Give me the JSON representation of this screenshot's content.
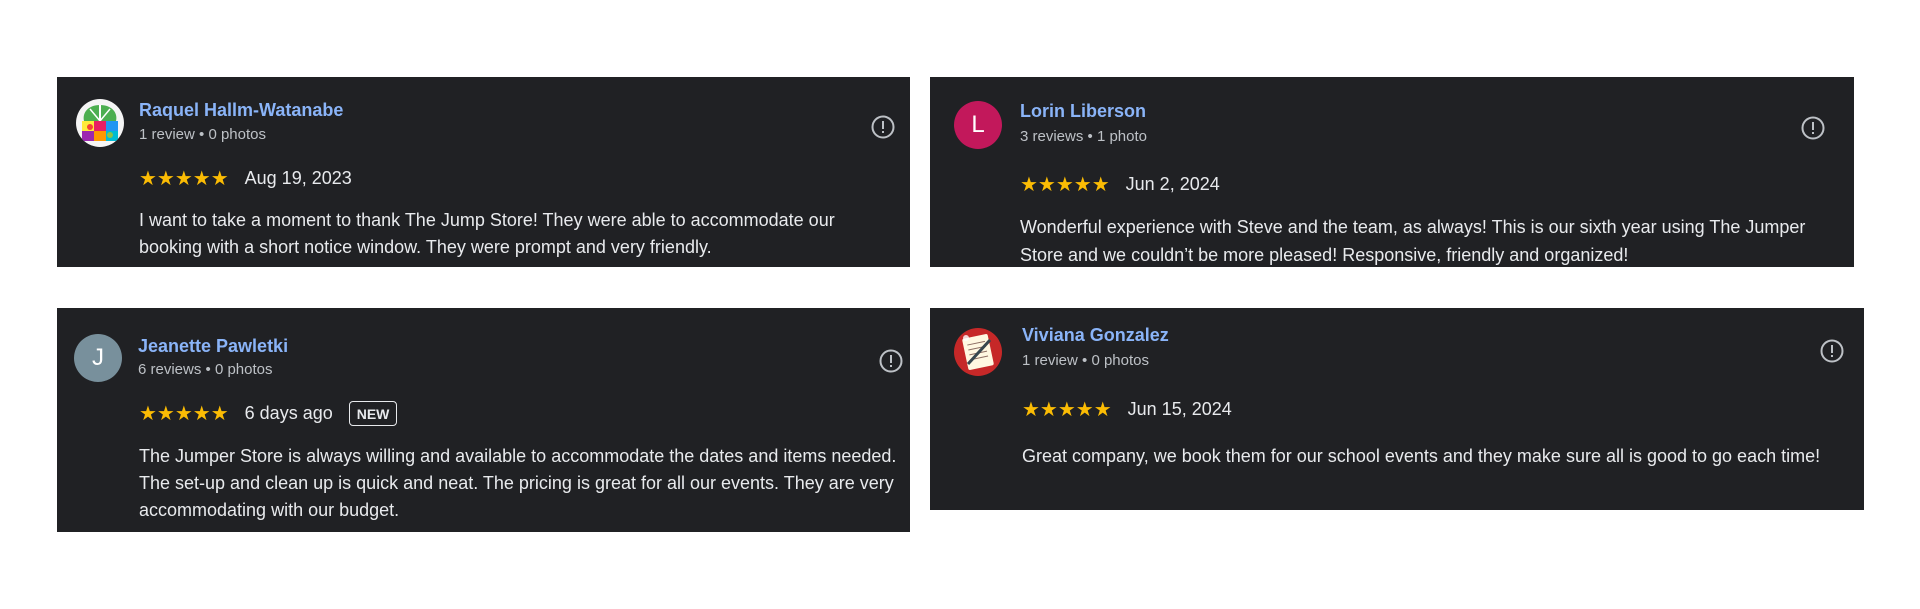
{
  "reviews": [
    {
      "reviewer": "Raquel Hallm-Watanabe",
      "meta": "1 review • 0 photos",
      "avatar_type": "image",
      "avatar_icon": "colorful-tree-avatar",
      "stars": "★★★★★",
      "rating": 5,
      "date": "Aug 19, 2023",
      "badge": "",
      "text": "I want to take a moment to thank The Jump Store! They were able to accommodate our booking with a short notice window. They were prompt and very friendly."
    },
    {
      "reviewer": "Lorin Liberson",
      "meta": "3 reviews • 1 photo",
      "avatar_type": "letter",
      "avatar_letter": "L",
      "avatar_color": "#c2185b",
      "stars": "★★★★★",
      "rating": 5,
      "date": "Jun 2, 2024",
      "badge": "",
      "text": "Wonderful experience with Steve and the team, as always! This is our sixth year using The Jumper Store and we couldn’t be more pleased! Responsive, friendly and organized!"
    },
    {
      "reviewer": "Jeanette Pawletki",
      "meta": "6 reviews • 0 photos",
      "avatar_type": "letter",
      "avatar_letter": "J",
      "avatar_color": "#78909c",
      "stars": "★★★★★",
      "rating": 5,
      "date": "6 days ago",
      "badge": "NEW",
      "text": "The Jumper Store is always willing and available to accommodate the dates and items needed. The set-up and clean up is quick and neat. The pricing is great for all our events. They are very accommodating with our budget."
    },
    {
      "reviewer": "Viviana Gonzalez",
      "meta": "1 review • 0 photos",
      "avatar_type": "image",
      "avatar_icon": "notebook-pen-avatar",
      "stars": "★★★★★",
      "rating": 5,
      "date": "Jun 15, 2024",
      "badge": "",
      "text": "Great company, we book them for our school events and they make sure all is good to go each time!"
    }
  ],
  "colors": {
    "card_bg": "#202124",
    "name_link": "#8ab4f8",
    "star": "#fbbc04",
    "text": "#e8eaed",
    "meta": "#bdc1c6"
  }
}
